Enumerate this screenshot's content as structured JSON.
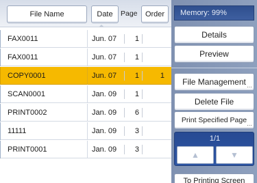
{
  "table": {
    "headers": {
      "file_name": "File Name",
      "date": "Date",
      "page": "Page",
      "order": "Order"
    },
    "rows": [
      {
        "name": "FAX0011",
        "date": "Jun. 07",
        "page": "1",
        "order": "",
        "selected": false
      },
      {
        "name": "FAX0011",
        "date": "Jun. 07",
        "page": "1",
        "order": "",
        "selected": false
      },
      {
        "name": "COPY0001",
        "date": "Jun. 07",
        "page": "1",
        "order": "1",
        "selected": true
      },
      {
        "name": "SCAN0001",
        "date": "Jan. 09",
        "page": "1",
        "order": "",
        "selected": false
      },
      {
        "name": "PRINT0002",
        "date": "Jan. 09",
        "page": "6",
        "order": "",
        "selected": false
      },
      {
        "name": "11111",
        "date": "Jan. 09",
        "page": "3",
        "order": "",
        "selected": false
      },
      {
        "name": "PRINT0001",
        "date": "Jan. 09",
        "page": "3",
        "order": "",
        "selected": false
      }
    ]
  },
  "sidebar": {
    "memory": "Memory:  99%",
    "details": "Details",
    "preview": "Preview",
    "file_management": "File Management",
    "delete_file": "Delete File",
    "print_specified_page": "Print Specified Page",
    "page_indicator": "1/1",
    "prev_arrow": "▲",
    "next_arrow": "▼",
    "to_printing_screen": "To Printing Screen"
  },
  "colors": {
    "selected_row": "#f6b900",
    "memory_bg": "#2f4f8e",
    "panel_bg": "#8ea0be"
  }
}
